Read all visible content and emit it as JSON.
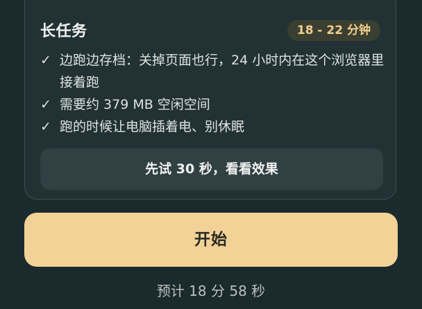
{
  "task_card": {
    "title": "长任务",
    "duration_badge": "18 - 22 分钟",
    "check_mark_glyph": "✓",
    "checklist": [
      {
        "text": "边跑边存档：关掉页面也行，24 小时内在这个浏览器里接着跑"
      },
      {
        "text": "需要约 379 MB 空闲空间"
      },
      {
        "text": "跑的时候让电脑插着电、别休眠"
      }
    ],
    "try_button_label": "先试 30 秒，看看效果"
  },
  "start_button_label": "开始",
  "estimate_text": "预计 18 分 58 秒",
  "colors": {
    "background": "#1b2a2c",
    "card": "#223234",
    "accent": "#f2d297",
    "badge_text": "#f1cf8e"
  }
}
